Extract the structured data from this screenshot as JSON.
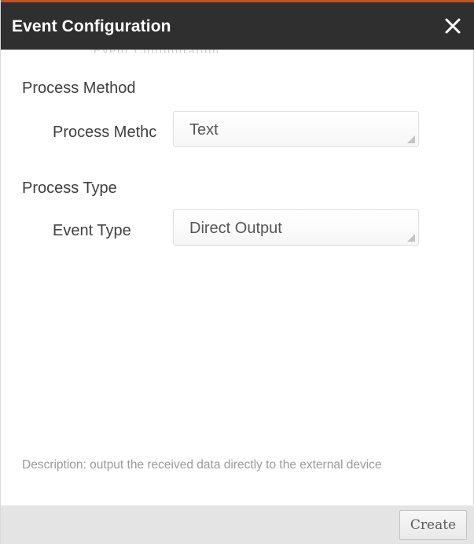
{
  "dialog": {
    "title": "Event Configuration",
    "close_icon": "close-icon",
    "ghost_text": "Event Configuration"
  },
  "sections": [
    {
      "heading": "Process Method",
      "field": {
        "label": "Process Methc",
        "value": "Text"
      }
    },
    {
      "heading": "Process Type",
      "field": {
        "label": "Event Type",
        "value": "Direct Output"
      }
    }
  ],
  "description": "Description: output the received data directly to the external device",
  "footer": {
    "create_label": "Create"
  },
  "colors": {
    "titlebar": "#2f2f2f",
    "accent": "#c8501e",
    "footer": "#e4e4e4"
  }
}
